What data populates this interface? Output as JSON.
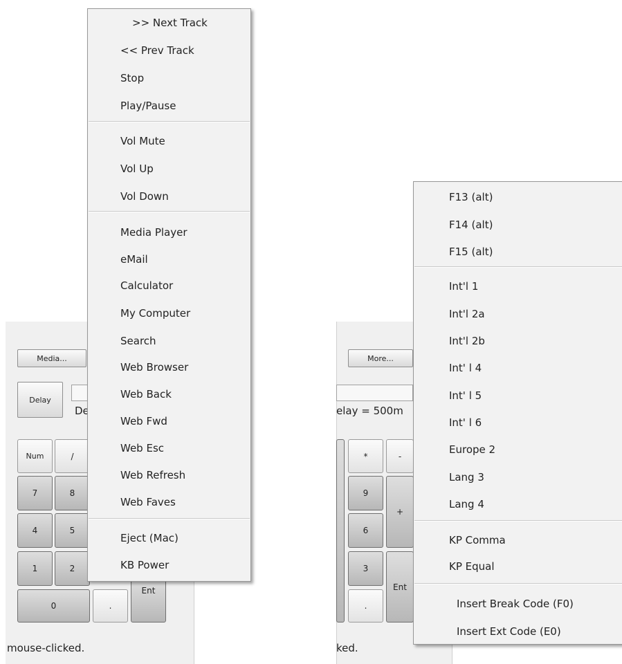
{
  "left_panel": {
    "media_button": "Media...",
    "delay_button": "Delay",
    "delay_label_partial": "De",
    "keys": {
      "num": "Num",
      "slash": "/",
      "k7": "7",
      "k8": "8",
      "k4": "4",
      "k5": "5",
      "k1": "1",
      "k2": "2",
      "k0": "0",
      "dot": ".",
      "ent": "Ent"
    },
    "status_text": "mouse-clicked."
  },
  "right_panel": {
    "more_button": "More...",
    "delay_label_partial": "elay = 500m",
    "keys": {
      "star": "*",
      "minus": "-",
      "k9": "9",
      "plus": "+",
      "k6": "6",
      "k3": "3",
      "ent": "Ent",
      "dot": "."
    },
    "status_text": "ked."
  },
  "media_menu": {
    "items": [
      ">> Next Track",
      "<< Prev Track",
      "Stop",
      "Play/Pause",
      "Vol Mute",
      "Vol Up",
      "Vol Down",
      "Media Player",
      "eMail",
      "Calculator",
      "My Computer",
      "Search",
      "Web Browser",
      "Web Back",
      "Web Fwd",
      "Web Esc",
      "Web Refresh",
      "Web Faves",
      "Eject (Mac)",
      "KB Power"
    ]
  },
  "more_menu": {
    "items": [
      "F13 (alt)",
      "F14 (alt)",
      "F15 (alt)",
      "Int'l 1",
      "Int'l 2a",
      "Int'l 2b",
      "Int' l 4",
      "Int' l 5",
      "Int' l 6",
      "Europe 2",
      "Lang 3",
      "Lang 4",
      "KP Comma",
      "KP Equal",
      "Insert Break Code (F0)",
      "Insert Ext Code (E0)"
    ]
  }
}
